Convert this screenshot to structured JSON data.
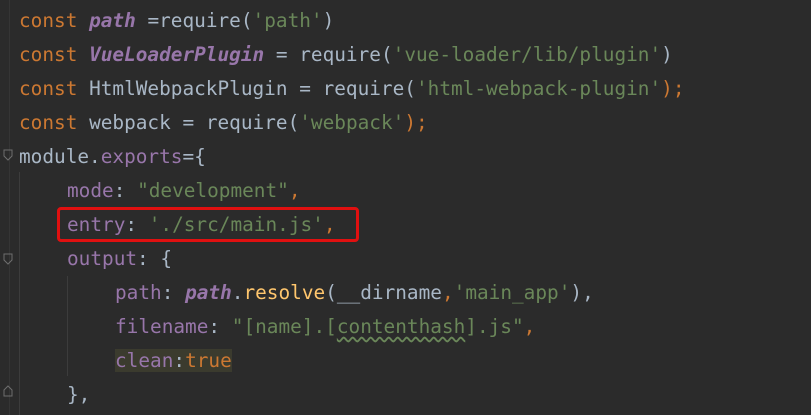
{
  "code": {
    "line1": {
      "kw": "const",
      "name": "path",
      "op": " =",
      "fn": "require",
      "open": "(",
      "arg": "'path'",
      "close": ")"
    },
    "line2": {
      "kw": "const",
      "name": "VueLoaderPlugin",
      "op": " = ",
      "fn": "require",
      "open": "(",
      "arg": "'vue-loader/lib/plugin'",
      "close": ")"
    },
    "line3": {
      "kw": "const",
      "name": "HtmlWebpackPlugin",
      "op": " = ",
      "fn": "require",
      "open": "(",
      "arg": "'html-webpack-plugin'",
      "close": ");"
    },
    "line4": {
      "kw": "const",
      "name": "webpack",
      "op": " = ",
      "fn": "require",
      "open": "(",
      "arg": "'webpack'",
      "close": ");"
    },
    "line5": {
      "obj": "module",
      "dot": ".",
      "prop": "exports",
      "rest": "={"
    },
    "line6": {
      "prop": "mode",
      "colon": ": ",
      "value": "\"development\"",
      "end": ","
    },
    "line7": {
      "prop": "entry",
      "colon": ": ",
      "value": "'./src/main.js'",
      "end": ","
    },
    "line8": {
      "prop": "output",
      "colon": ": ",
      "rest": "{"
    },
    "line9": {
      "prop": "path",
      "colon": ": ",
      "obj": "path",
      "dot": ".",
      "fn": "resolve",
      "open": "(",
      "arg1": "__dirname",
      "comma": ",",
      "arg2": "'main_app'",
      "close": "),"
    },
    "line10": {
      "prop": "filename",
      "colon": ": ",
      "value_pre": "\"[name].[",
      "value_sq": "contenthash",
      "value_post": "].js\"",
      "end": ","
    },
    "line11": {
      "prop": "clean",
      "colon": ":",
      "value": "true"
    },
    "line12": {
      "text": "},"
    }
  },
  "colors": {
    "background": "#2b2b2b",
    "keyword": "#cc7832",
    "string": "#6a8759",
    "property": "#9876aa",
    "function": "#ffc66d",
    "highlight_border": "#e01010"
  }
}
